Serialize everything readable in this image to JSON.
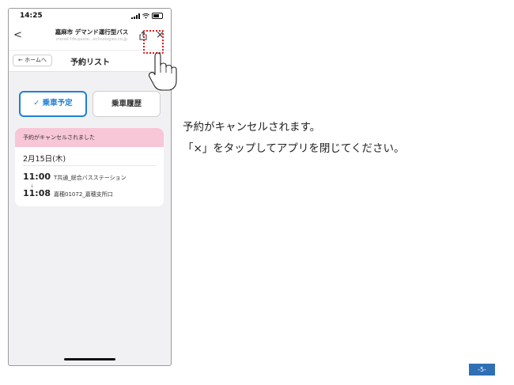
{
  "status": {
    "time": "14:25"
  },
  "nav": {
    "back": "<",
    "title": "嘉麻市 デマンド運行型バス",
    "url": "monet-life-passe...echnologies.co.jp",
    "close": "×"
  },
  "subbar": {
    "home_button": "← ホームへ",
    "title": "予約リスト"
  },
  "tabs": {
    "upcoming": "✓ 乗車予定",
    "history": "乗車履歴"
  },
  "reservation": {
    "banner": "予約がキャンセルされました",
    "date": "2月15日(木)",
    "departure_time": "11:00",
    "departure_stop": "T共通_総合バスステーション",
    "arrow": "↓",
    "arrival_time": "11:08",
    "arrival_stop": "嘉穂01072_嘉穂支所口"
  },
  "instructions": {
    "line1": "予約がキャンセルされます。",
    "line2": "「×」をタップしてアプリを閉じてください。"
  },
  "page_number": "-5-",
  "colors": {
    "accent": "#1f7fd6",
    "banner": "#f7c6d7",
    "highlight": "#e01818",
    "badge": "#2f6fb3"
  },
  "icons": [
    "back-chevron-icon",
    "share-icon",
    "close-icon",
    "hand-pointer-icon",
    "check-icon"
  ]
}
